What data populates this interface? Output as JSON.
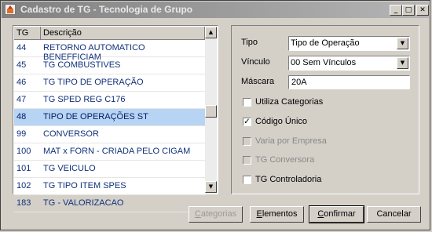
{
  "window": {
    "title": "Cadastro de TG - Tecnologia de Grupo"
  },
  "titlebar_buttons": {
    "minimize": "_",
    "maximize": "□",
    "close": "✕"
  },
  "grid": {
    "headers": [
      "TG",
      "Descrição"
    ],
    "rows": [
      {
        "tg": "44",
        "desc": "RETORNO AUTOMATICO BENEFFICIAM"
      },
      {
        "tg": "45",
        "desc": "TG COMBUSTIVES"
      },
      {
        "tg": "46",
        "desc": "TG TIPO DE OPERAÇÃO"
      },
      {
        "tg": "47",
        "desc": "TG SPED REG C176"
      },
      {
        "tg": "48",
        "desc": "TIPO DE OPERAÇÕES ST"
      },
      {
        "tg": "99",
        "desc": "CONVERSOR"
      },
      {
        "tg": "100",
        "desc": "MAT x FORN - CRIADA PELO CIGAM"
      },
      {
        "tg": "101",
        "desc": "TG VEICULO"
      },
      {
        "tg": "102",
        "desc": "TG TIPO ITEM SPES"
      },
      {
        "tg": "183",
        "desc": "TG - VALORIZACAO"
      }
    ],
    "selected_index": 4,
    "scroll_up_glyph": "▲",
    "scroll_down_glyph": "▼"
  },
  "form": {
    "tipo_label": "Tipo",
    "tipo_value": "Tipo de Operação",
    "vinculo_label": "Vínculo",
    "vinculo_value": "00 Sem Vínculos",
    "mascara_label": "Máscara",
    "mascara_value": "20A",
    "combo_arrow_glyph": "▼",
    "check_glyph": "✓",
    "checkboxes": [
      {
        "label": "Utiliza Categorias",
        "checked": false,
        "enabled": true
      },
      {
        "label": "Código Único",
        "checked": true,
        "enabled": true
      },
      {
        "label": "Varia por Empresa",
        "checked": false,
        "enabled": false
      },
      {
        "label": "TG Conversora",
        "checked": false,
        "enabled": false
      },
      {
        "label": "TG Controladoria",
        "checked": false,
        "enabled": true
      }
    ]
  },
  "buttons": {
    "categorias": {
      "first": "C",
      "rest": "ategorias",
      "enabled": false
    },
    "elementos": {
      "first": "E",
      "rest": "lementos",
      "enabled": true
    },
    "confirmar": {
      "first": "C",
      "rest": "onfirmar",
      "enabled": true,
      "default": true
    },
    "cancelar": {
      "label": "Cancelar",
      "enabled": true
    }
  },
  "colors": {
    "selected_row": "#b8d4f4",
    "row_text": "#10307a",
    "title_gradient_start": "#808080"
  }
}
